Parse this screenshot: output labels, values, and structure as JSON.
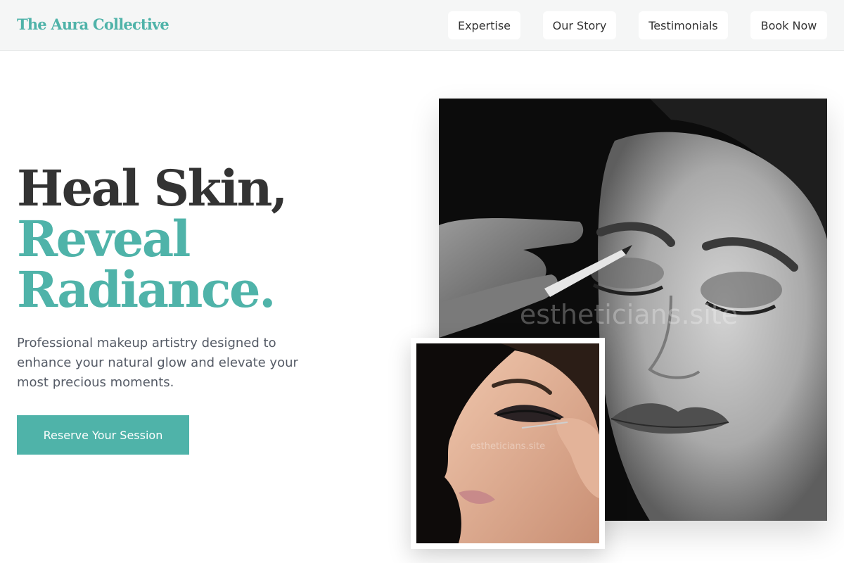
{
  "header": {
    "brand": "The Aura Collective",
    "nav": [
      {
        "label": "Expertise"
      },
      {
        "label": "Our Story"
      },
      {
        "label": "Testimonials"
      },
      {
        "label": "Book Now"
      }
    ]
  },
  "hero": {
    "headline_line1": "Heal Skin,",
    "headline_line2": "Reveal",
    "headline_line3": "Radiance.",
    "subtext": "Professional makeup artistry designed to enhance your natural glow and elevate your most precious moments.",
    "cta_label": "Reserve Your Session"
  },
  "images": {
    "main_watermark": "estheticians.site",
    "inset_watermark": "estheticians.site"
  },
  "colors": {
    "accent": "#4fb3a9",
    "headline_dark": "#333333",
    "header_bg": "#f5f6f6"
  }
}
